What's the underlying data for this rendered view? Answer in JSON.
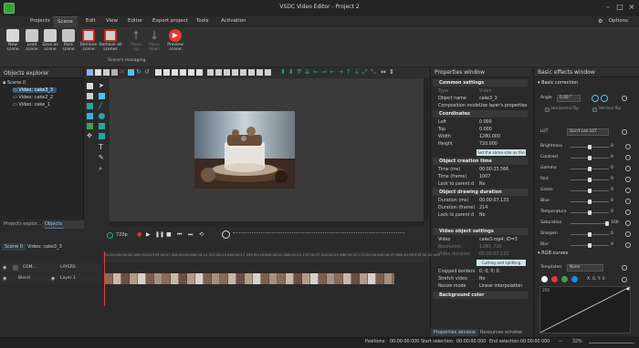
{
  "window": {
    "title": "VSDC Video Editor - Project 2",
    "options_label": "Options"
  },
  "menu": [
    "Projects",
    "Scene",
    "Edit",
    "View",
    "Editor",
    "Export project",
    "Tools",
    "Activation"
  ],
  "ribbon": {
    "buttons": [
      {
        "label": "New\nscene",
        "enabled": true
      },
      {
        "label": "Load\nscene",
        "enabled": true
      },
      {
        "label": "Save as\nscene",
        "enabled": true
      },
      {
        "label": "Pack\nscene",
        "enabled": true
      },
      {
        "label": "Remove\nscene",
        "enabled": true
      },
      {
        "label": "Remove all\nscenes",
        "enabled": true
      },
      {
        "label": "Move\nup",
        "enabled": false
      },
      {
        "label": "Move\ndown",
        "enabled": false
      },
      {
        "label": "Preview\nscene",
        "enabled": true
      }
    ],
    "group_label": "Scene's managing"
  },
  "objects_explorer": {
    "title": "Objects explorer",
    "tree": [
      "Scene 0",
      "Video: cake3_3",
      "Video: cake2_2",
      "Video: cake_1"
    ],
    "tabs": [
      "Projects explor...",
      "Objects explorer"
    ]
  },
  "properties": {
    "title": "Properties window",
    "common_settings": "Common settings",
    "type_label": "Type",
    "type_value": "Video",
    "object_name_label": "Object name",
    "object_name_value": "cake3_3",
    "comp_mode_label": "Composition mode",
    "comp_mode_value": "Use layer's properties",
    "coordinates": "Coordinates",
    "left_label": "Left",
    "left_value": "0.000",
    "top_label": "Top",
    "top_value": "0.000",
    "width_label": "Width",
    "width_value": "1280.000",
    "height_label": "Height",
    "height_value": "720.000",
    "same_size_btn": "Set the same size as the parent has",
    "creation_time": "Object creation time",
    "time_ms_label": "Time (ms)",
    "time_ms_value": "00:00:33.566",
    "time_frame_label": "Time (frame)",
    "time_frame_value": "1007",
    "lock1_label": "Lock to parent d",
    "lock1_value": "No",
    "drawing_duration": "Object drawing duration",
    "duration_ms_label": "Duration (ms)",
    "duration_ms_value": "00:00:07.133",
    "duration_frame_label": "Duration (frame)",
    "duration_frame_value": "214",
    "lock2_label": "Lock to parent d",
    "lock2_value": "No",
    "video_settings": "Video object settings",
    "video_label": "Video",
    "video_value": "cake3.mp4; ID=3",
    "resolution_label": "Resolution",
    "resolution_value": "1280; 720",
    "video_duration_label": "Video duration",
    "video_duration_value": "00:00:07.133",
    "cut_split_btn": "Cutting and splitting",
    "cropped_label": "Cropped borders",
    "cropped_value": "0; 0; 0; 0",
    "stretch_label": "Stretch video",
    "stretch_value": "No",
    "resize_label": "Resize mode",
    "resize_value": "Linear interpolation",
    "bg_color": "Background color",
    "tabs": [
      "Properties window",
      "Resources window"
    ]
  },
  "effects": {
    "title": "Basic effects window",
    "basic_correction": "Basic correction",
    "angle_label": "Angle",
    "angle_value": "0.00 °",
    "hflip_label": "Horizontal flip",
    "vflip_label": "Vertical flip",
    "lut_label": "LUT",
    "lut_value": "Don't use LUT",
    "rows": [
      {
        "label": "Brightness",
        "value": "0",
        "pos": 0.5
      },
      {
        "label": "Contrast",
        "value": "0",
        "pos": 0.5
      },
      {
        "label": "Gamma",
        "value": "0",
        "pos": 0.5
      },
      {
        "label": "Red",
        "value": "0",
        "pos": 0.5
      },
      {
        "label": "Green",
        "value": "0",
        "pos": 0.5
      },
      {
        "label": "Blue",
        "value": "0",
        "pos": 0.5
      },
      {
        "label": "Temperature",
        "value": "0",
        "pos": 0.5
      },
      {
        "label": "Saturation",
        "value": "100",
        "pos": 1.0
      },
      {
        "label": "Sharpen",
        "value": "0",
        "pos": 0.5
      },
      {
        "label": "Blur",
        "value": "0",
        "pos": 0.5
      }
    ],
    "rgb_curves": "RGB curves",
    "templates_label": "Templates:",
    "templates_value": "None",
    "coords_value": "X: 0, Y: 0",
    "curve_top_value": "255",
    "curve_colors": [
      "#ffffff",
      "#e53935",
      "#43a047",
      "#1e88e5"
    ]
  },
  "timeline": {
    "zoom": "720p",
    "scene_tabs": [
      "Scene 0",
      "Video: cake3_3"
    ],
    "layers_label": "LAYERS",
    "com_label": "COM...",
    "blend_label": "Blend",
    "layer_name": "Layer 1",
    "ticks": [
      "00:00.000",
      "00:02.466",
      "00:04.933",
      "00:07.400",
      "00:09.866",
      "00:12.333",
      "00:14.800",
      "00:17.333",
      "00:19.800",
      "00:22.266",
      "00:24.733",
      "00:27.200",
      "00:29.666",
      "00:32.133",
      "00:34.600",
      "00:37.066",
      "00:39.533",
      "00:42.000"
    ]
  },
  "status": {
    "positions_label": "Positions:",
    "positions_value": "00:00:00.000",
    "start_label": "Start selection:",
    "start_value": "00:00:00.000",
    "end_label": "End selection:",
    "end_value": "00:00:00.000",
    "zoom_value": "32%"
  }
}
